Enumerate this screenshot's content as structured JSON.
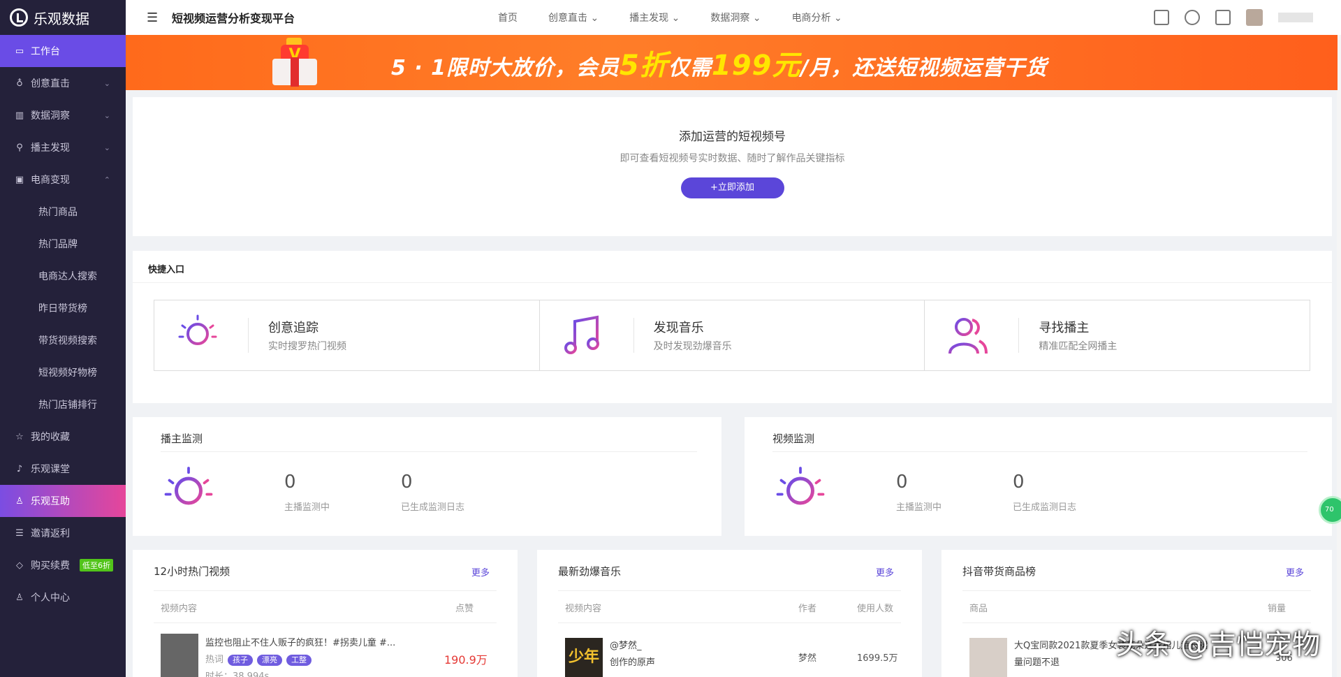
{
  "app": {
    "logo_text": "乐观数据",
    "platform_title": "短视频运营分析变现平台"
  },
  "topnav": [
    {
      "label": "首页"
    },
    {
      "label": "创意直击"
    },
    {
      "label": "播主发现"
    },
    {
      "label": "数据洞察"
    },
    {
      "label": "电商分析"
    }
  ],
  "sidebar": {
    "workbench": "工作台",
    "creative": "创意直击",
    "insight": "数据洞察",
    "host_discover": "播主发现",
    "ecommerce": "电商变现",
    "sub": [
      "热门商品",
      "热门品牌",
      "电商达人搜索",
      "昨日带货榜",
      "带货视频搜索",
      "短视频好物榜",
      "热门店铺排行"
    ],
    "favorites": "我的收藏",
    "classroom": "乐观课堂",
    "mutual": "乐观互助",
    "invite": "邀请返利",
    "buy": "购买续费",
    "buy_badge": "低至6折",
    "profile": "个人中心"
  },
  "banner": {
    "part1": "5 · 1限时大放价，会员",
    "part2": "5折",
    "part3": "仅需",
    "part4": "199元",
    "part5": "/月，还送短视频运营干货",
    "gift_letter": "V"
  },
  "add_account": {
    "title": "添加运营的短视频号",
    "subtitle": "即可查看短视频号实时数据、随时了解作品关键指标",
    "button": "+立即添加"
  },
  "quick": {
    "title": "快捷入口",
    "items": [
      {
        "name": "创意追踪",
        "desc": "实时搜罗热门视频"
      },
      {
        "name": "发现音乐",
        "desc": "及时发现劲爆音乐"
      },
      {
        "name": "寻找播主",
        "desc": "精准匹配全网播主"
      }
    ]
  },
  "monitor": {
    "host": {
      "title": "播主监测",
      "count1": "0",
      "label1": "主播监测中",
      "count2": "0",
      "label2": "已生成监测日志"
    },
    "video": {
      "title": "视频监测",
      "count1": "0",
      "label1": "主播监测中",
      "count2": "0",
      "label2": "已生成监测日志"
    }
  },
  "hot_videos": {
    "title": "12小时热门视频",
    "more": "更多",
    "col1": "视频内容",
    "col2": "点赞",
    "row": {
      "title": "监控也阻止不住人贩子的疯狂！#拐卖儿童 #...",
      "tag_prefix": "热词",
      "tags": [
        "孩子",
        "漂亮",
        "工整"
      ],
      "duration": "时长：38.994s",
      "likes": "190.9万"
    }
  },
  "hot_music": {
    "title": "最新劲爆音乐",
    "more": "更多",
    "col1": "视频内容",
    "col2": "作者",
    "col3": "使用人数",
    "row": {
      "name": "@梦然_",
      "sub": "创作的原声",
      "author": "梦然",
      "users": "1699.5万",
      "thumb_text": "少年"
    }
  },
  "goods": {
    "title": "抖音带货商品榜",
    "more": "更多",
    "col1": "商品",
    "col2": "销量",
    "row": {
      "name": "大Q宝同款2021款夏季女装花朵连衣裙儿童长裙",
      "sub": "量问题不退",
      "sales": "306"
    }
  },
  "watermark": "头条 @吉恺宠物",
  "float_ball": "70"
}
